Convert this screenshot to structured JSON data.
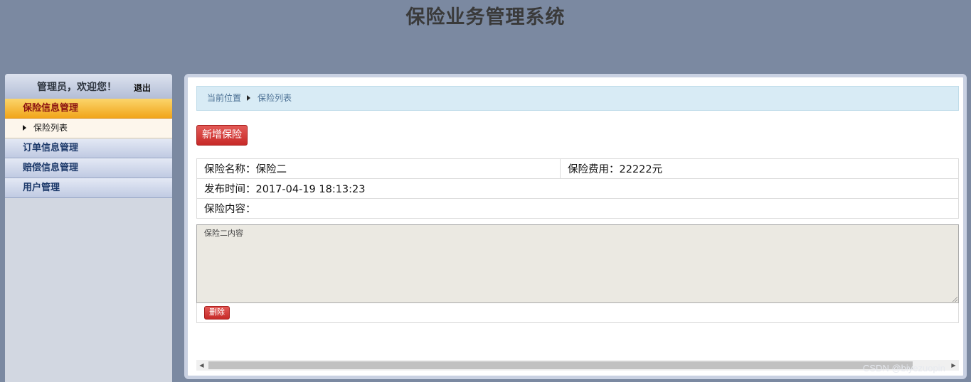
{
  "header": {
    "title": "保险业务管理系统"
  },
  "sidebar": {
    "welcome": "管理员，欢迎您！",
    "logout": "退出",
    "menu": [
      {
        "label": "保险信息管理"
      },
      {
        "label": "保险列表"
      },
      {
        "label": "订单信息管理"
      },
      {
        "label": "赔偿信息管理"
      },
      {
        "label": "用户管理"
      }
    ]
  },
  "breadcrumb": {
    "current_position": "当前位置",
    "page": "保险列表"
  },
  "actions": {
    "add_label": "新增保险",
    "delete_label": "删除"
  },
  "record": {
    "name": "保险名称：保险二",
    "fee": "保险费用：22222元",
    "publish_time": "发布时间：2017-04-19 18:13:23",
    "content_label": "保险内容：",
    "content_text": "保险二内容"
  },
  "watermark": "CSDN @biyezuopin"
}
